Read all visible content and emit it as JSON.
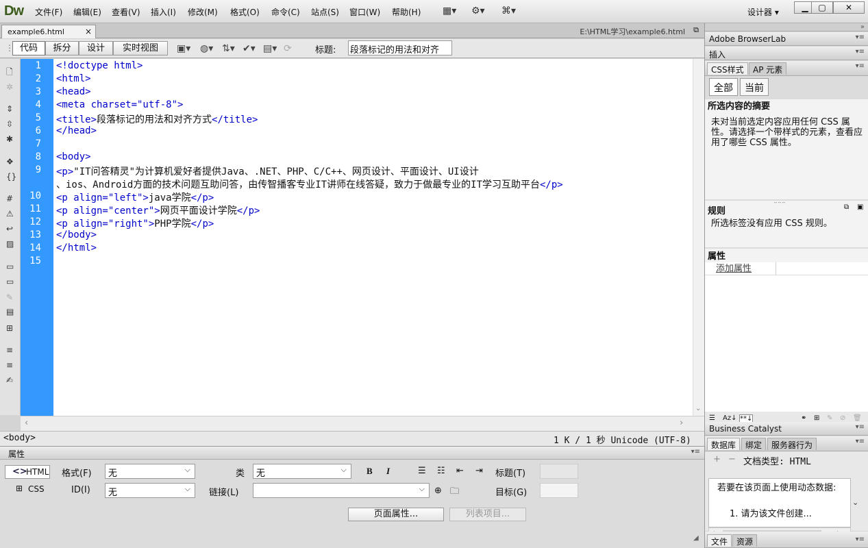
{
  "app": {
    "logo": "Dw",
    "menus": [
      "文件(F)",
      "编辑(E)",
      "查看(V)",
      "插入(I)",
      "修改(M)",
      "格式(O)",
      "命令(C)",
      "站点(S)",
      "窗口(W)",
      "帮助(H)"
    ],
    "workspace": "设计器 ▾"
  },
  "document": {
    "tab_name": "example6.html",
    "path": "E:\\HTML学习\\example6.html",
    "view_buttons": [
      "代码",
      "拆分",
      "设计",
      "实时视图"
    ],
    "title_label": "标题:",
    "title_value": "段落标记的用法和对齐"
  },
  "code": {
    "line_numbers": [
      "1",
      "2",
      "3",
      "4",
      "5",
      "6",
      "7",
      "8",
      "9",
      "",
      "10",
      "11",
      "12",
      "13",
      "14",
      "15"
    ],
    "lines": [
      "<!doctype html>",
      "<html>",
      "<head>",
      "<meta charset=\"utf-8\">",
      "<title>段落标记的用法和对齐方式</title>",
      "</head>",
      "",
      "<body>",
      "<p>\"IT问答精灵\"为计算机爱好者提供Java、.NET、PHP、C/C++、网页设计、平面设计、UI设计",
      "、ios、Android方面的技术问题互助问答，由传智播客专业IT讲师在线答疑，致力于做最专业的IT学习互助平台</p>",
      "<p align=\"left\">java学院</p>",
      "<p align=\"center\">网页平面设计学院</p>",
      "<p align=\"right\">PHP学院</p>",
      "</body>",
      "</html>",
      ""
    ]
  },
  "status": {
    "tag": "<body>",
    "info": "1 K / 1 秒 Unicode (UTF-8)"
  },
  "properties": {
    "header": "属性",
    "html_btn": "HTML",
    "css_btn": "CSS",
    "format_label": "格式(F)",
    "format_value": "无",
    "id_label": "ID(I)",
    "id_value": "无",
    "class_label": "类",
    "class_value": "无",
    "link_label": "链接(L)",
    "link_value": "",
    "bold": "B",
    "italic": "I",
    "title_label": "标题(T)",
    "target_label": "目标(G)",
    "page_props_btn": "页面属性...",
    "list_item_btn": "列表项目..."
  },
  "panels": {
    "browserlab": "Adobe BrowserLab",
    "insert": "插入",
    "css_tab": "CSS样式",
    "ap_tab": "AP 元素",
    "all_btn": "全部",
    "current_btn": "当前",
    "summary_title": "所选内容的摘要",
    "summary_text": "未对当前选定内容应用任何 CSS 属性。请选择一个带样式的元素，查看应用了哪些 CSS 属性。",
    "rules_title": "规则",
    "rules_text": "所选标签没有应用 CSS 规则。",
    "attr_title": "属性",
    "add_attr": "添加属性",
    "bc": "Business Catalyst",
    "db_tab": "数据库",
    "bind_tab": "绑定",
    "server_tab": "服务器行为",
    "doc_type": "文档类型: HTML",
    "dyn_text": "若要在该页面上使用动态数据:",
    "dyn_sub": "1. 请为该文件创建...",
    "files_tab": "文件",
    "assets_tab": "资源"
  }
}
